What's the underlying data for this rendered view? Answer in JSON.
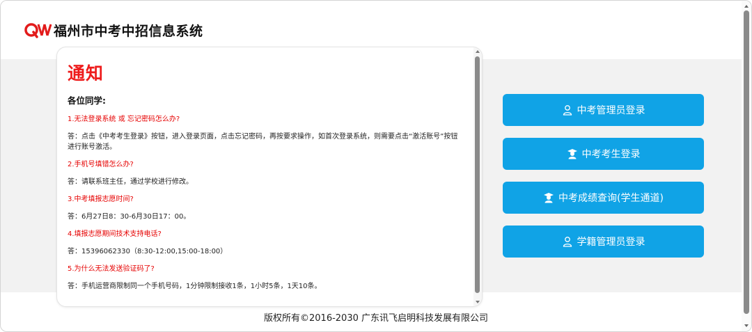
{
  "header": {
    "title": "福州市中考中招信息系统",
    "logo_icon": "brand-logo-icon"
  },
  "notice": {
    "title": "通知",
    "greeting": "各位同学:",
    "items": [
      {
        "q": "1.无法登录系统 或 忘记密码怎么办?",
        "a": "答：点击《中考考生登录》按钮，进入登录页面，点击忘记密码，再按要求操作，如首次登录系统，则需要点击“激活账号”按钮进行账号激活。"
      },
      {
        "q": "2.手机号填错怎么办?",
        "a": "答：请联系班主任，通过学校进行修改。"
      },
      {
        "q": "3.中考填报志愿时间?",
        "a": "答：6月27日8：30-6月30日17：00。"
      },
      {
        "q": "4.填报志愿期间技术支持电话?",
        "a": "答：15396062330（8:30-12:00,15:00-18:00）"
      },
      {
        "q": "5.为什么无法发送验证码了?",
        "a": "答：手机运营商限制同一个手机号码，1分钟限制接收1条，1小时5条，1天10条。"
      }
    ]
  },
  "buttons": {
    "admin_login": "中考管理员登录",
    "student_login": "中考考生登录",
    "score_query": "中考成绩查询(学生通道)",
    "registry_admin_login": "学籍管理员登录"
  },
  "footer": {
    "copyright": "版权所有©2016-2030 广东讯飞启明科技发展有限公司"
  },
  "colors": {
    "accent": "#10a3e6",
    "alert_red": "#ee1c1c",
    "band_gray": "#f2f2f2"
  }
}
